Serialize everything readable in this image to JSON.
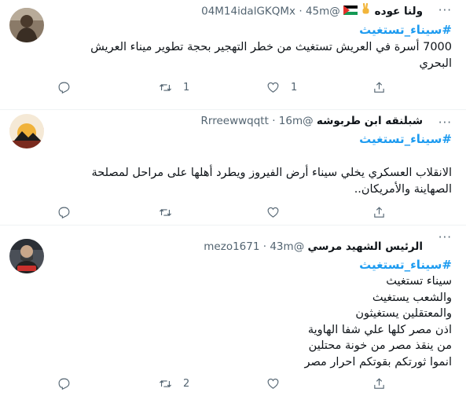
{
  "tweets": [
    {
      "name": "ولنا عوده",
      "handle": "@04M14idalGKQMx",
      "dot": "·",
      "time": "45m",
      "hashtag": "#سيناء_تستغيث",
      "body_lines": [
        "7000 أسرة في العريش تستغيث من خطر التهجير بحجة تطوير ميناء العريش",
        "البحري"
      ],
      "reply_count": "",
      "retweet_count": "1",
      "like_count": "1",
      "icons": [
        "palestine-flag-icon",
        "victory-hand-icon"
      ]
    },
    {
      "name": "شبلنقه ابن طربوشه",
      "handle": "@Rrreewwqqtt",
      "dot": "·",
      "time": "16m",
      "hashtag": "#سيناء_تستغيث",
      "body_lines": [
        "الانقلاب العسكري يخلي سيناء أرض الفيروز ويطرد أهلها على مراحل لمصلحة",
        "الصهاينة والأمريكان.."
      ],
      "reply_count": "",
      "retweet_count": "",
      "like_count": ""
    },
    {
      "name": "الرئيس الشهيد مرسي",
      "handle": "@mezo1671",
      "dot": "·",
      "time": "43m",
      "hashtag": "#سيناء_تستغيث",
      "body_lines": [
        "سيناء تستغيث",
        "والشعب يستغيث",
        "والمعتقلين يستغيثون",
        "اذن مصر كلها علي شفا الهاوية",
        "من ينقذ مصر من خونة محتلين",
        "انموا ثورتكم بقوتكم احرار مصر"
      ],
      "reply_count": "",
      "retweet_count": "2",
      "like_count": ""
    }
  ],
  "more_label": "···",
  "colors": {
    "hashtag": "#1d9bf0",
    "muted": "#536471",
    "text": "#0f1419",
    "divider": "#eff3f4"
  }
}
